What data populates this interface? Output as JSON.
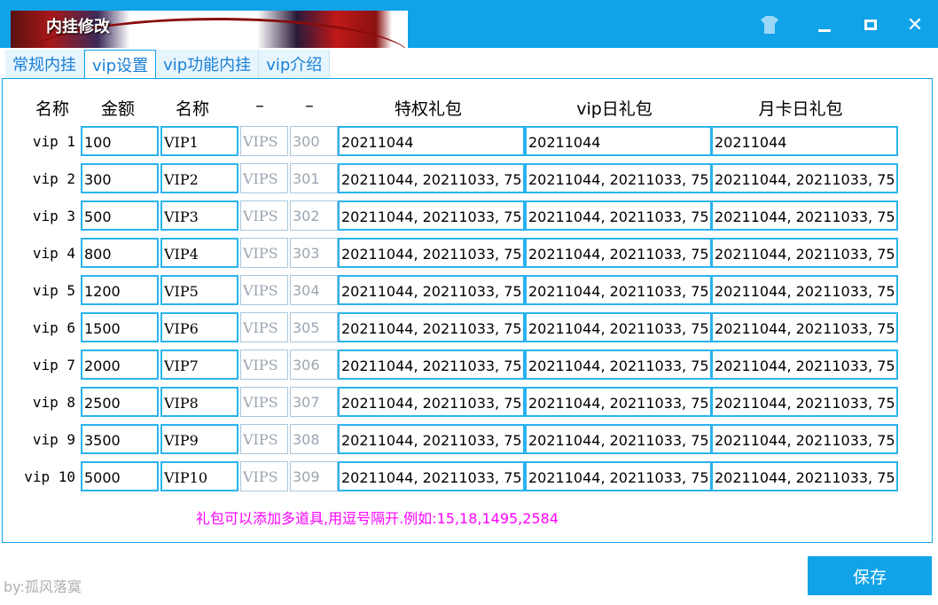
{
  "window": {
    "title": "内挂修改"
  },
  "tabs": [
    {
      "label": "常规内挂"
    },
    {
      "label": "vip设置"
    },
    {
      "label": "vip功能内挂"
    },
    {
      "label": "vip介绍"
    }
  ],
  "active_tab": "vip设置",
  "headers": [
    "名称",
    "金额",
    "名称",
    "–",
    "–",
    "特权礼包",
    "vip日礼包",
    "月卡日礼包"
  ],
  "rows": [
    {
      "label": "vip 1",
      "amount": "100",
      "name": "VIP1",
      "col4": "VIPS",
      "col5": "300",
      "privilege": "20211044",
      "daily": "20211044",
      "monthly": "20211044"
    },
    {
      "label": "vip 2",
      "amount": "300",
      "name": "VIP2",
      "col4": "VIPS",
      "col5": "301",
      "privilege": "20211044, 20211033, 75",
      "daily": "20211044, 20211033, 75",
      "monthly": "20211044, 20211033, 75"
    },
    {
      "label": "vip 3",
      "amount": "500",
      "name": "VIP3",
      "col4": "VIPS",
      "col5": "302",
      "privilege": "20211044, 20211033, 75",
      "daily": "20211044, 20211033, 75",
      "monthly": "20211044, 20211033, 75"
    },
    {
      "label": "vip 4",
      "amount": "800",
      "name": "VIP4",
      "col4": "VIPS",
      "col5": "303",
      "privilege": "20211044, 20211033, 75",
      "daily": "20211044, 20211033, 75",
      "monthly": "20211044, 20211033, 75"
    },
    {
      "label": "vip 5",
      "amount": "1200",
      "name": "VIP5",
      "col4": "VIPS",
      "col5": "304",
      "privilege": "20211044, 20211033, 75",
      "daily": "20211044, 20211033, 75",
      "monthly": "20211044, 20211033, 75"
    },
    {
      "label": "vip 6",
      "amount": "1500",
      "name": "VIP6",
      "col4": "VIPS",
      "col5": "305",
      "privilege": "20211044, 20211033, 75",
      "daily": "20211044, 20211033, 75",
      "monthly": "20211044, 20211033, 75"
    },
    {
      "label": "vip 7",
      "amount": "2000",
      "name": "VIP7",
      "col4": "VIPS",
      "col5": "306",
      "privilege": "20211044, 20211033, 75",
      "daily": "20211044, 20211033, 75",
      "monthly": "20211044, 20211033, 75"
    },
    {
      "label": "vip 8",
      "amount": "2500",
      "name": "VIP8",
      "col4": "VIPS",
      "col5": "307",
      "privilege": "20211044, 20211033, 75",
      "daily": "20211044, 20211033, 75",
      "monthly": "20211044, 20211033, 75"
    },
    {
      "label": "vip 9",
      "amount": "3500",
      "name": "VIP9",
      "col4": "VIPS",
      "col5": "308",
      "privilege": "20211044, 20211033, 75",
      "daily": "20211044, 20211033, 75",
      "monthly": "20211044, 20211033, 75"
    },
    {
      "label": "vip 10",
      "amount": "5000",
      "name": "VIP10",
      "col4": "VIPS",
      "col5": "309",
      "privilege": "20211044, 20211033, 75",
      "daily": "20211044, 20211033, 75",
      "monthly": "20211044, 20211033, 75"
    }
  ],
  "note": "礼包可以添加多道具,用逗号隔开.例如:15,18,1495,2584",
  "footer": {
    "author": "by:孤风落寞",
    "save_label": "保存"
  },
  "colors": {
    "accent": "#10a3e8",
    "tab_text": "#1a7fd6",
    "note": "#ff00ff"
  },
  "icons": [
    "skin-shirt-icon",
    "minimize-icon",
    "maximize-icon",
    "close-icon"
  ]
}
